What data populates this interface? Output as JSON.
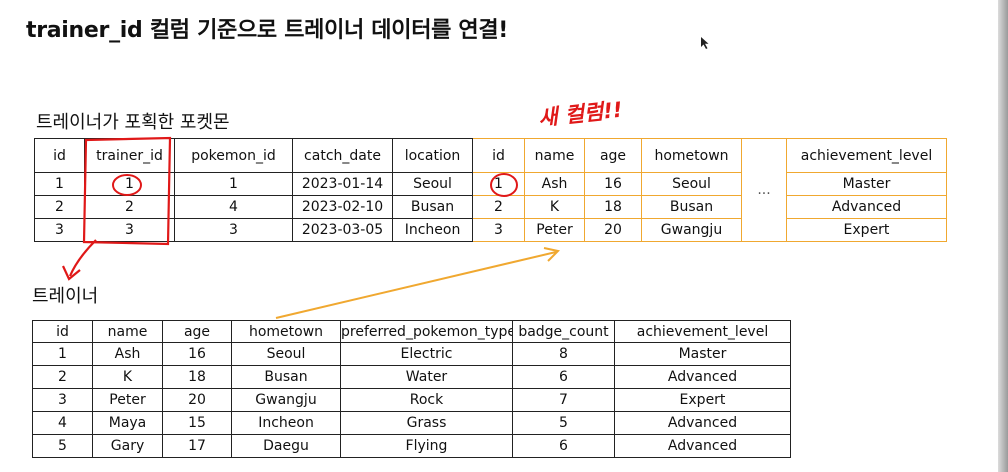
{
  "title": "trainer_id 컬럼 기준으로 트레이너 데이터를 연결!",
  "caught_label": "트레이너가 포획한 포켓몬",
  "trainer_label": "트레이너",
  "annotation": "새 컬럼!!",
  "colors": {
    "join_border": "#f0a830",
    "annotation": "#e01818",
    "text": "#111111"
  },
  "caught_table": {
    "headers": [
      "id",
      "trainer_id",
      "pokemon_id",
      "catch_date",
      "location",
      "id",
      "name",
      "age",
      "hometown",
      "",
      "achievement_level"
    ],
    "rows": [
      [
        "1",
        "1",
        "1",
        "2023-01-14",
        "Seoul",
        "1",
        "Ash",
        "16",
        "Seoul",
        "...",
        "Master"
      ],
      [
        "2",
        "2",
        "4",
        "2023-02-10",
        "Busan",
        "2",
        "K",
        "18",
        "Busan",
        "",
        "Advanced"
      ],
      [
        "3",
        "3",
        "3",
        "2023-03-05",
        "Incheon",
        "3",
        "Peter",
        "20",
        "Gwangju",
        "",
        "Expert"
      ]
    ]
  },
  "trainer_table": {
    "headers": [
      "id",
      "name",
      "age",
      "hometown",
      "preferred_pokemon_type",
      "badge_count",
      "achievement_level"
    ],
    "rows": [
      [
        "1",
        "Ash",
        "16",
        "Seoul",
        "Electric",
        "8",
        "Master"
      ],
      [
        "2",
        "K",
        "18",
        "Busan",
        "Water",
        "6",
        "Advanced"
      ],
      [
        "3",
        "Peter",
        "20",
        "Gwangju",
        "Rock",
        "7",
        "Expert"
      ],
      [
        "4",
        "Maya",
        "15",
        "Incheon",
        "Grass",
        "5",
        "Advanced"
      ],
      [
        "5",
        "Gary",
        "17",
        "Daegu",
        "Flying",
        "6",
        "Advanced"
      ]
    ]
  }
}
